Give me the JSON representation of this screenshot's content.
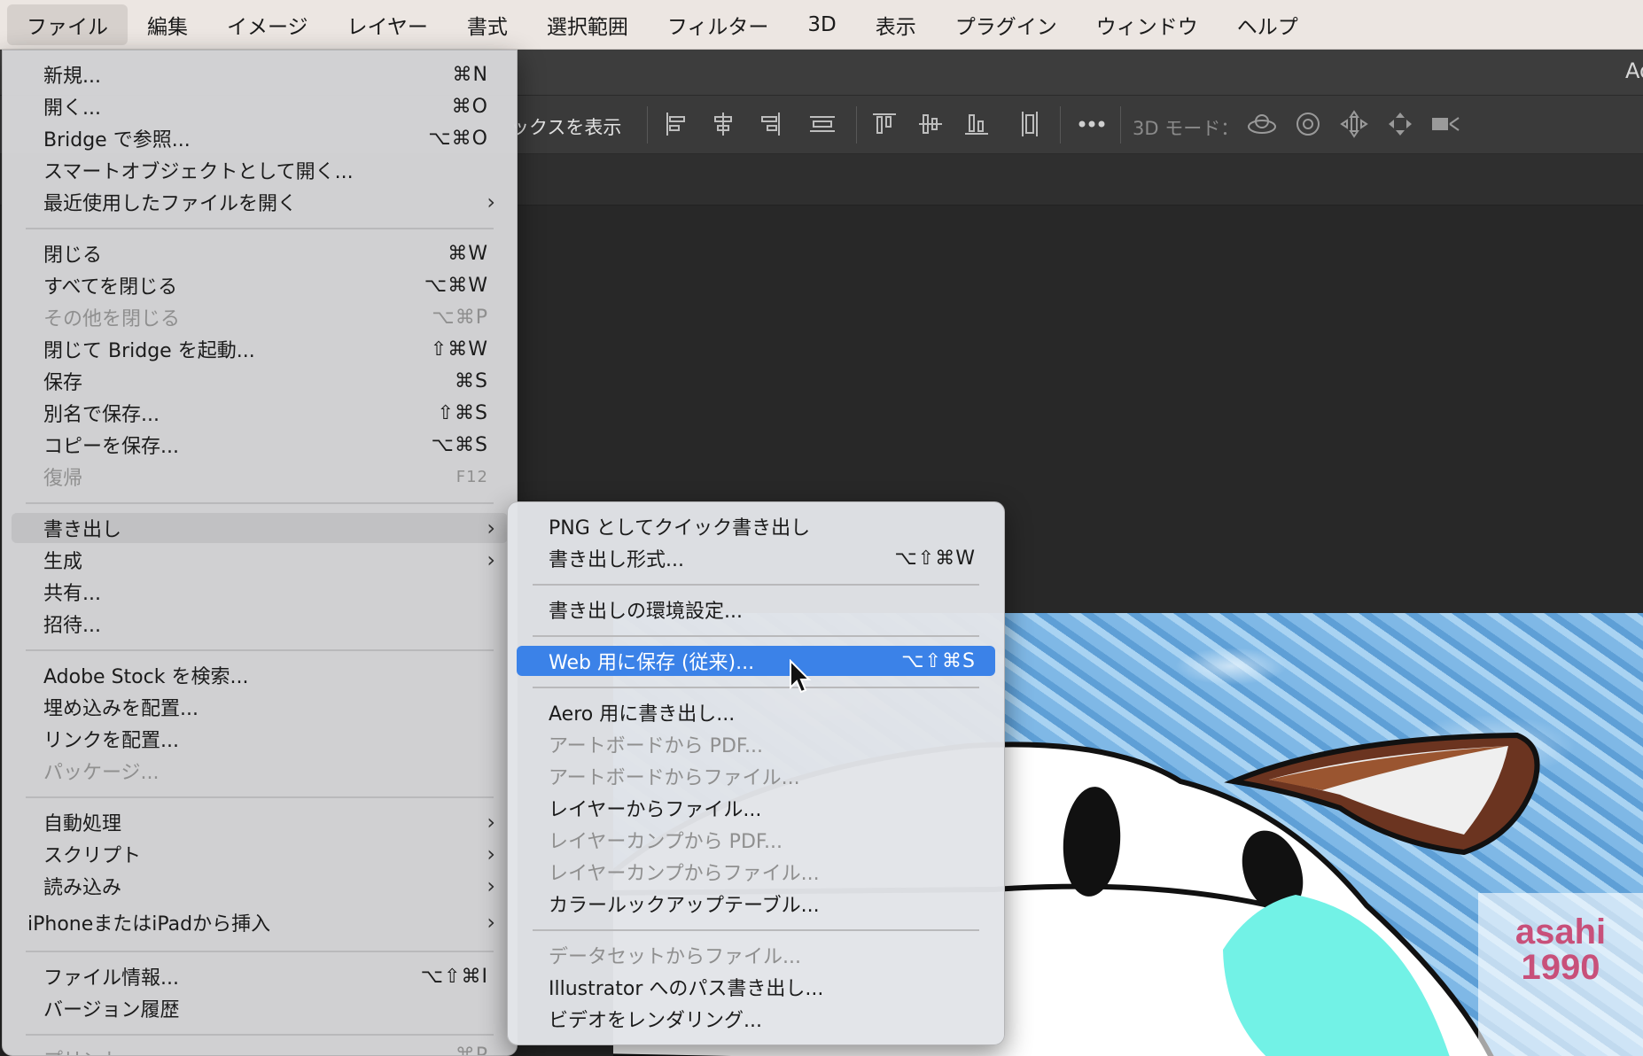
{
  "menubar": {
    "items": [
      "ファイル",
      "編集",
      "イメージ",
      "レイヤー",
      "書式",
      "選択範囲",
      "フィルター",
      "3D",
      "表示",
      "プラグイン",
      "ウィンドウ",
      "ヘルプ"
    ]
  },
  "titlebar": {
    "app_title": "Ad"
  },
  "options": {
    "show_box_label": "ックスを表示",
    "mode_label": "3D モード："
  },
  "file_menu": {
    "items": [
      {
        "label": "新規...",
        "shortcut": "⌘N"
      },
      {
        "label": "開く...",
        "shortcut": "⌘O"
      },
      {
        "label": "Bridge で参照...",
        "shortcut": "⌥⌘O"
      },
      {
        "label": "スマートオブジェクトとして開く...",
        "shortcut": ""
      },
      {
        "label": "最近使用したファイルを開く",
        "submenu": true
      },
      {
        "label": "閉じる",
        "shortcut": "⌘W"
      },
      {
        "label": "すべてを閉じる",
        "shortcut": "⌥⌘W"
      },
      {
        "label": "その他を閉じる",
        "shortcut": "⌥⌘P",
        "disabled": true
      },
      {
        "label": "閉じて Bridge を起動...",
        "shortcut": "⇧⌘W"
      },
      {
        "label": "保存",
        "shortcut": "⌘S"
      },
      {
        "label": "別名で保存...",
        "shortcut": "⇧⌘S"
      },
      {
        "label": "コピーを保存...",
        "shortcut": "⌥⌘S"
      },
      {
        "label": "復帰",
        "shortcut": "F12",
        "disabled": true
      },
      {
        "label": "書き出し",
        "submenu": true,
        "highlight": true
      },
      {
        "label": "生成",
        "submenu": true
      },
      {
        "label": "共有...",
        "shortcut": ""
      },
      {
        "label": "招待...",
        "shortcut": ""
      },
      {
        "label": "Adobe Stock を検索...",
        "shortcut": ""
      },
      {
        "label": "埋め込みを配置...",
        "shortcut": ""
      },
      {
        "label": "リンクを配置...",
        "shortcut": ""
      },
      {
        "label": "パッケージ...",
        "shortcut": "",
        "disabled": true
      },
      {
        "label": "自動処理",
        "submenu": true
      },
      {
        "label": "スクリプト",
        "submenu": true
      },
      {
        "label": "読み込み",
        "submenu": true
      },
      {
        "label": "iPhoneまたはiPadから挿入",
        "submenu": true
      },
      {
        "label": "ファイル情報...",
        "shortcut": "⌥⇧⌘I"
      },
      {
        "label": "バージョン履歴",
        "shortcut": ""
      },
      {
        "label": "プリント...",
        "shortcut": "⌘P",
        "disabled": true
      }
    ]
  },
  "export_menu": {
    "items": [
      {
        "label": "PNG としてクイック書き出し",
        "shortcut": ""
      },
      {
        "label": "書き出し形式...",
        "shortcut": "⌥⇧⌘W"
      },
      {
        "label": "書き出しの環境設定...",
        "shortcut": ""
      },
      {
        "label": "Web 用に保存 (従来)...",
        "shortcut": "⌥⇧⌘S",
        "selected": true
      },
      {
        "label": "Aero 用に書き出し...",
        "shortcut": ""
      },
      {
        "label": "アートボードから PDF...",
        "shortcut": "",
        "disabled": true
      },
      {
        "label": "アートボードからファイル...",
        "shortcut": "",
        "disabled": true
      },
      {
        "label": "レイヤーからファイル...",
        "shortcut": ""
      },
      {
        "label": "レイヤーカンプから PDF...",
        "shortcut": "",
        "disabled": true
      },
      {
        "label": "レイヤーカンプからファイル...",
        "shortcut": "",
        "disabled": true
      },
      {
        "label": "カラールックアップテーブル...",
        "shortcut": ""
      },
      {
        "label": "データセットからファイル...",
        "shortcut": "",
        "disabled": true
      },
      {
        "label": "Illustrator へのパス書き出し...",
        "shortcut": ""
      },
      {
        "label": "ビデオをレンダリング...",
        "shortcut": ""
      }
    ]
  },
  "canvas": {
    "watermark_line1": "asahi",
    "watermark_line2": "1990"
  },
  "colors": {
    "selection_blue": "#3b82e8",
    "cheek_cyan": "#72f2e6",
    "ear_brown": "#8a4a2a"
  },
  "icons": {
    "submenu_chevron": "chevron-right-icon",
    "align_group": [
      "align-left-icon",
      "align-center-icon",
      "align-right-icon",
      "distribute-horizontal-icon",
      "align-top-icon",
      "align-middle-icon",
      "align-bottom-icon",
      "distribute-vertical-icon",
      "more-icon"
    ],
    "mode_3d_group": [
      "orbit-3d-icon",
      "roll-3d-icon",
      "drag-3d-icon",
      "slide-3d-icon",
      "camera-3d-icon"
    ]
  }
}
